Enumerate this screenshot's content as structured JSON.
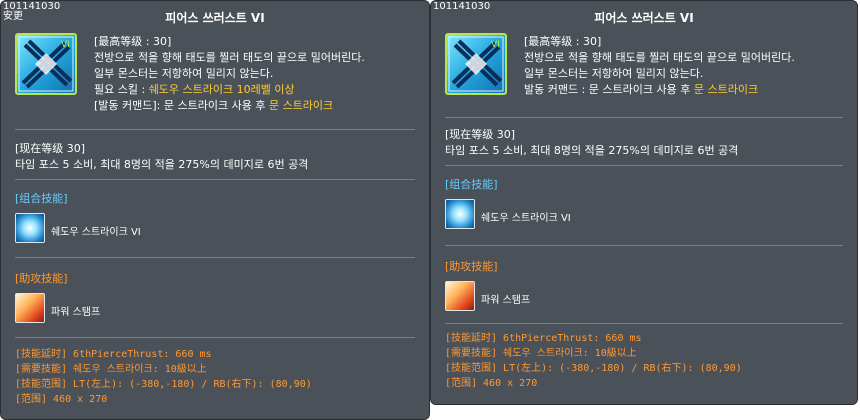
{
  "panels": [
    {
      "skill_id": "101141030",
      "sub_label": "安更",
      "title": "피어스 쓰러스트 VI",
      "max_level": "[最高等级 : 30]",
      "desc_line1": "전방으로 적을 향해 태도를 찔러 태도의 끝으로 밀어버린다.",
      "desc_line2": "일부 몬스터는 저항하여 밀리지 않는다.",
      "req_prefix": "필요 스킬 : ",
      "req_value": "쉐도우 스트라이크 10레벨 이상",
      "cmd_prefix": "[발동 커맨드]: 문 스트라이크 사용 후 ",
      "cmd_value": "문 스트라이크",
      "current_level": "[现在等级 30]",
      "current_desc": "타임 포스 5 소비, 최대 8명의 적을 275%의 데미지로 6번 공격",
      "combo_header": "[组合技能]",
      "combo_skill": "쉐도우 스트라이크 VI",
      "assist_header": "[助攻技能]",
      "assist_skill": "파워 스탬프",
      "info_lines": [
        "[技能延时] 6thPierceThrust: 660 ms",
        "[需要技能] 쉐도우 스트라이크: 10級以上",
        "[技能范围] LT(左上): (-380,-180) / RB(右下): (80,90)",
        "[范围] 460 x 270"
      ]
    },
    {
      "skill_id": "101141030",
      "title": "피어스 쓰러스트 VI",
      "max_level": "[最高等级 : 30]",
      "desc_line1": "전방으로 적을 향해 태도를 찔러 태도의 끝으로 밀어버린다.",
      "desc_line2": "일부 몬스터는 저항하여 밀리지 않는다.",
      "cmd_prefix": "발동 커맨드 : 문 스트라이크 사용 후 ",
      "cmd_value": "문 스트라이크",
      "current_level": "[现在等级 30]",
      "current_desc": "타임 포스 5 소비, 최대 8명의 적을 275%의 데미지로 6번 공격",
      "combo_header": "[组合技能]",
      "combo_skill": "쉐도우 스트라이크 VI",
      "assist_header": "[助攻技能]",
      "assist_skill": "파워 스탬프",
      "info_lines": [
        "[技能延时] 6thPierceThrust: 660 ms",
        "[需要技能] 쉐도우 스트라이크: 10級以上",
        "[技能范围] LT(左上): (-380,-180) / RB(右下): (80,90)",
        "[范围] 460 x 270"
      ]
    }
  ],
  "icons": {
    "main": "crossed-blades-skill-icon",
    "combo": "shadow-strike-icon",
    "assist": "power-stamp-icon"
  },
  "colors": {
    "panel_bg": "#4a5158",
    "highlight": "#ffcc33",
    "header_blue": "#66ccff",
    "header_orange": "#ff9933"
  }
}
